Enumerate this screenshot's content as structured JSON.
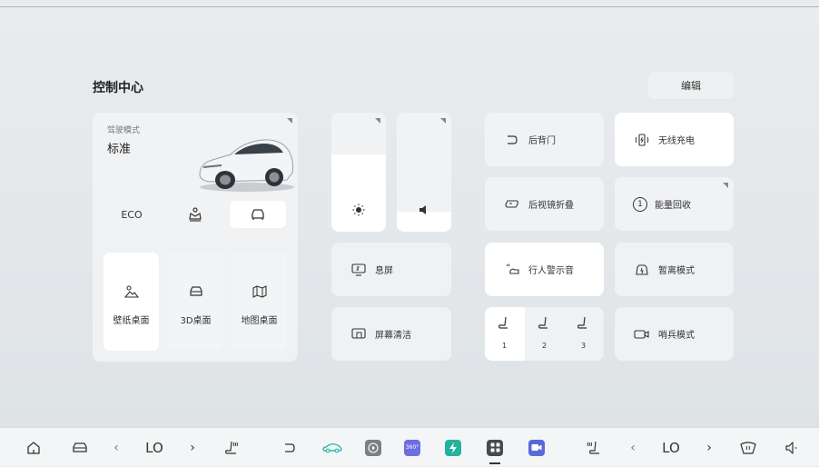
{
  "header": {
    "title": "控制中心",
    "edit_label": "编辑"
  },
  "drive": {
    "label": "驾驶模式",
    "current": "标准",
    "modes": [
      "ECO",
      "sport-crown",
      "car-outline"
    ],
    "selected_index": 2
  },
  "desktops": [
    {
      "label": "壁纸桌面",
      "icon": "landscape-icon"
    },
    {
      "label": "3D桌面",
      "icon": "car-front-icon"
    },
    {
      "label": "地图桌面",
      "icon": "map-icon"
    }
  ],
  "sliders": {
    "brightness_level": 0.65,
    "volume_level": 0.17
  },
  "middle_tiles": {
    "screen_off": "息屏",
    "screen_clean": "屏幕清洁"
  },
  "tiles": {
    "tailgate": "后背门",
    "wireless_charge": "无线充电",
    "mirror_fold": "后视镜折叠",
    "energy_recovery": "能量回收",
    "energy_recovery_level": "1",
    "pedestrian_warning": "行人警示音",
    "temp_leave": "暂离模式",
    "sentry": "哨兵模式"
  },
  "seat_levels": [
    "1",
    "2",
    "3"
  ],
  "taskbar": {
    "left_temp": "LO",
    "right_temp": "LO",
    "app_icon_labels": [
      "360°"
    ],
    "colors": {
      "car_app": "#2bbfae",
      "media_app": "#7a7f85",
      "cam360_app": "#6d6fe0",
      "charge_app": "#23b2a0",
      "control_app": "#444a51",
      "video_app": "#5a69d8"
    }
  }
}
